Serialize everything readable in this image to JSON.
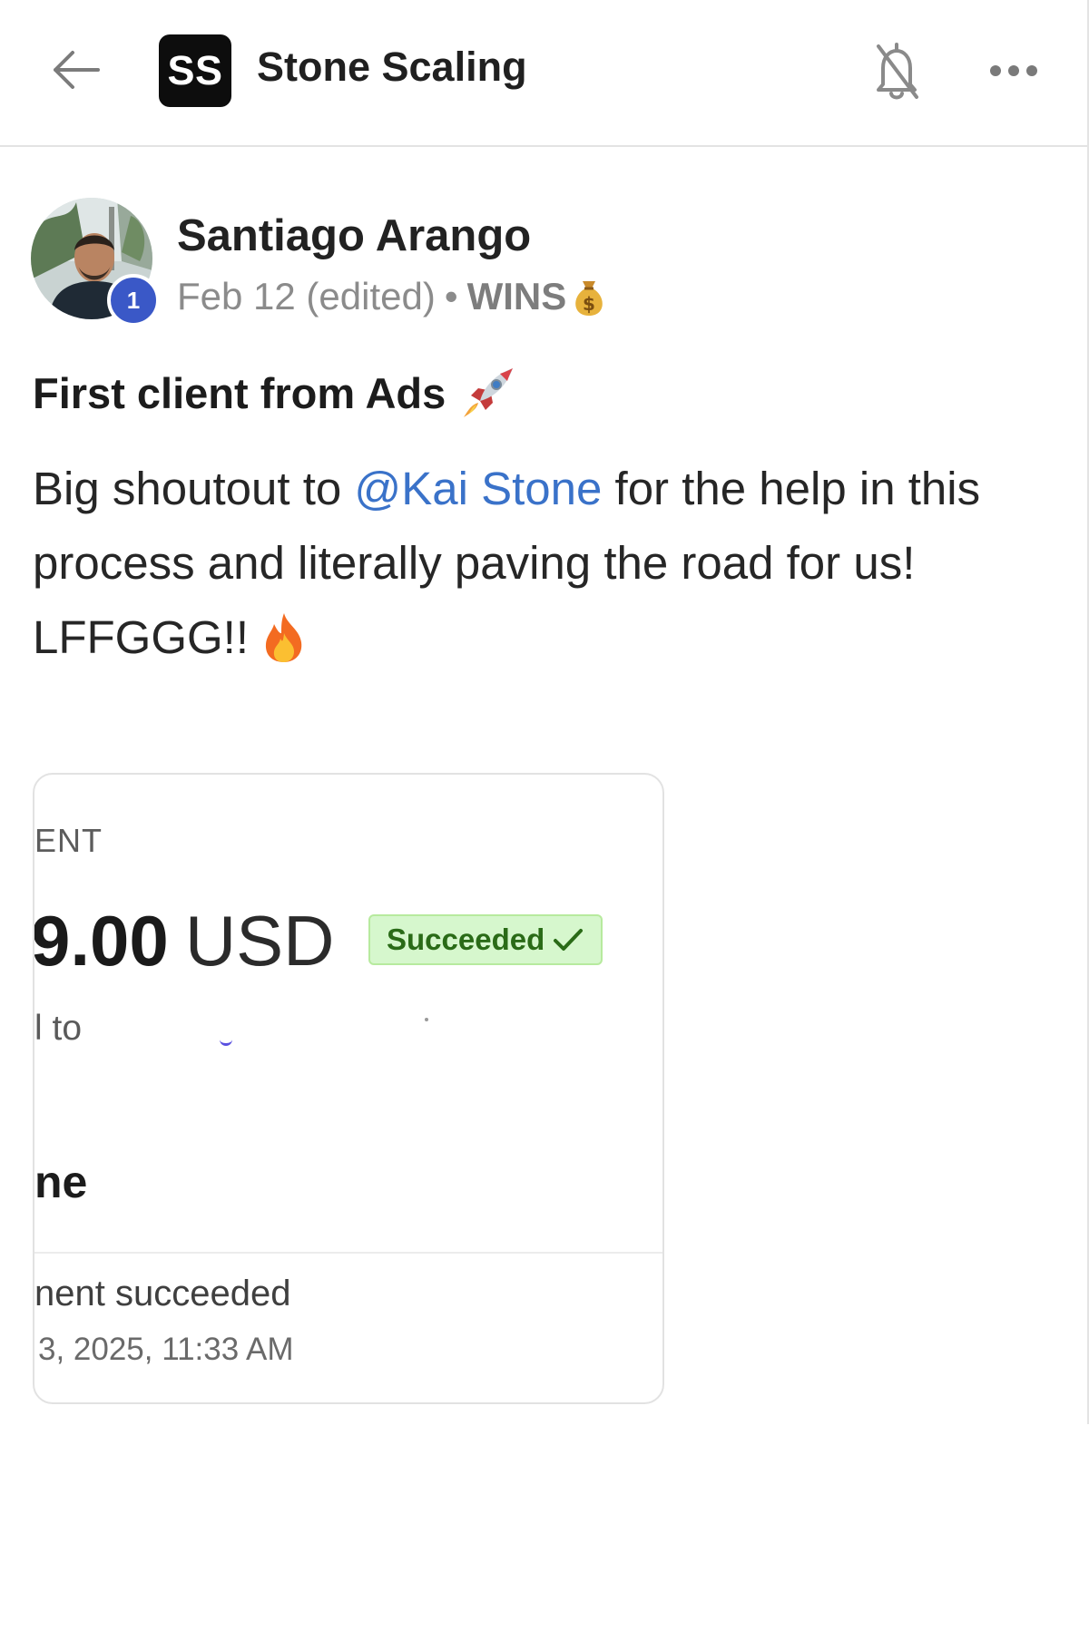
{
  "header": {
    "logo_text": "SS",
    "group_name": "Stone Scaling",
    "icons": {
      "back": "arrow-left-icon",
      "notifications": "bell-off-icon",
      "more": "more-horizontal-icon"
    }
  },
  "post": {
    "author": {
      "name": "Santiago Arango",
      "level": "1"
    },
    "meta": {
      "date": "Feb 12 (edited)",
      "separator": "•",
      "category": "WINS"
    },
    "title": "First client from Ads",
    "body": {
      "line1_prefix": "Big shoutout to ",
      "mention": "@Kai Stone",
      "line1_suffix": " for the help in this process and literally paving the road for us!",
      "line2": "LFFGGG!!"
    },
    "emojis": {
      "category": "money-bag-icon",
      "title": "rocket-icon",
      "body": "fire-icon"
    }
  },
  "attachment": {
    "label": "ENT",
    "amount_number": "9.00",
    "amount_currency": "USD",
    "status": "Succeeded",
    "sent_to": "l to",
    "section_heading": "ne",
    "event": "nent succeeded",
    "timestamp": "3, 2025, 11:33 AM"
  },
  "colors": {
    "mention": "#3a72c9",
    "level_badge": "#3a58c7",
    "success_bg": "#d6f7cd",
    "success_text": "#2a6b17"
  }
}
